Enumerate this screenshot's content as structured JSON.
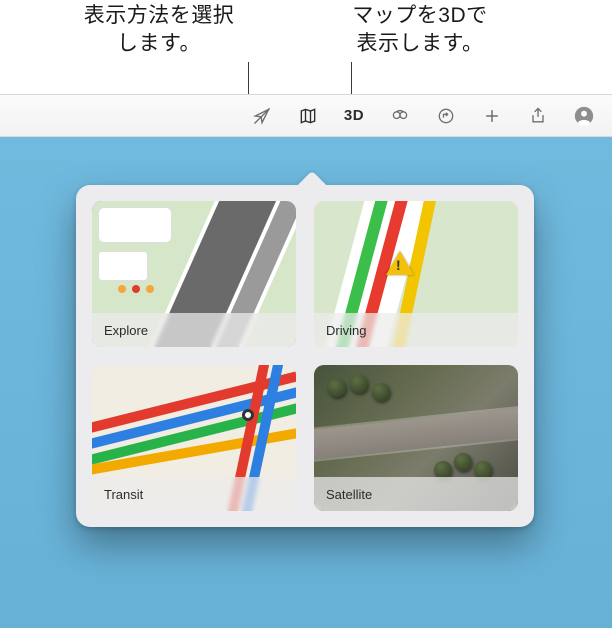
{
  "callouts": {
    "choose_view_l1": "表示方法を選択",
    "choose_view_l2": "します。",
    "show_3d_l1": "マップを3Dで",
    "show_3d_l2": "表示します。"
  },
  "toolbar": {
    "three_d_label": "3D"
  },
  "popover": {
    "tiles": {
      "explore": "Explore",
      "driving": "Driving",
      "transit": "Transit",
      "satellite": "Satellite"
    },
    "selected": "explore"
  }
}
